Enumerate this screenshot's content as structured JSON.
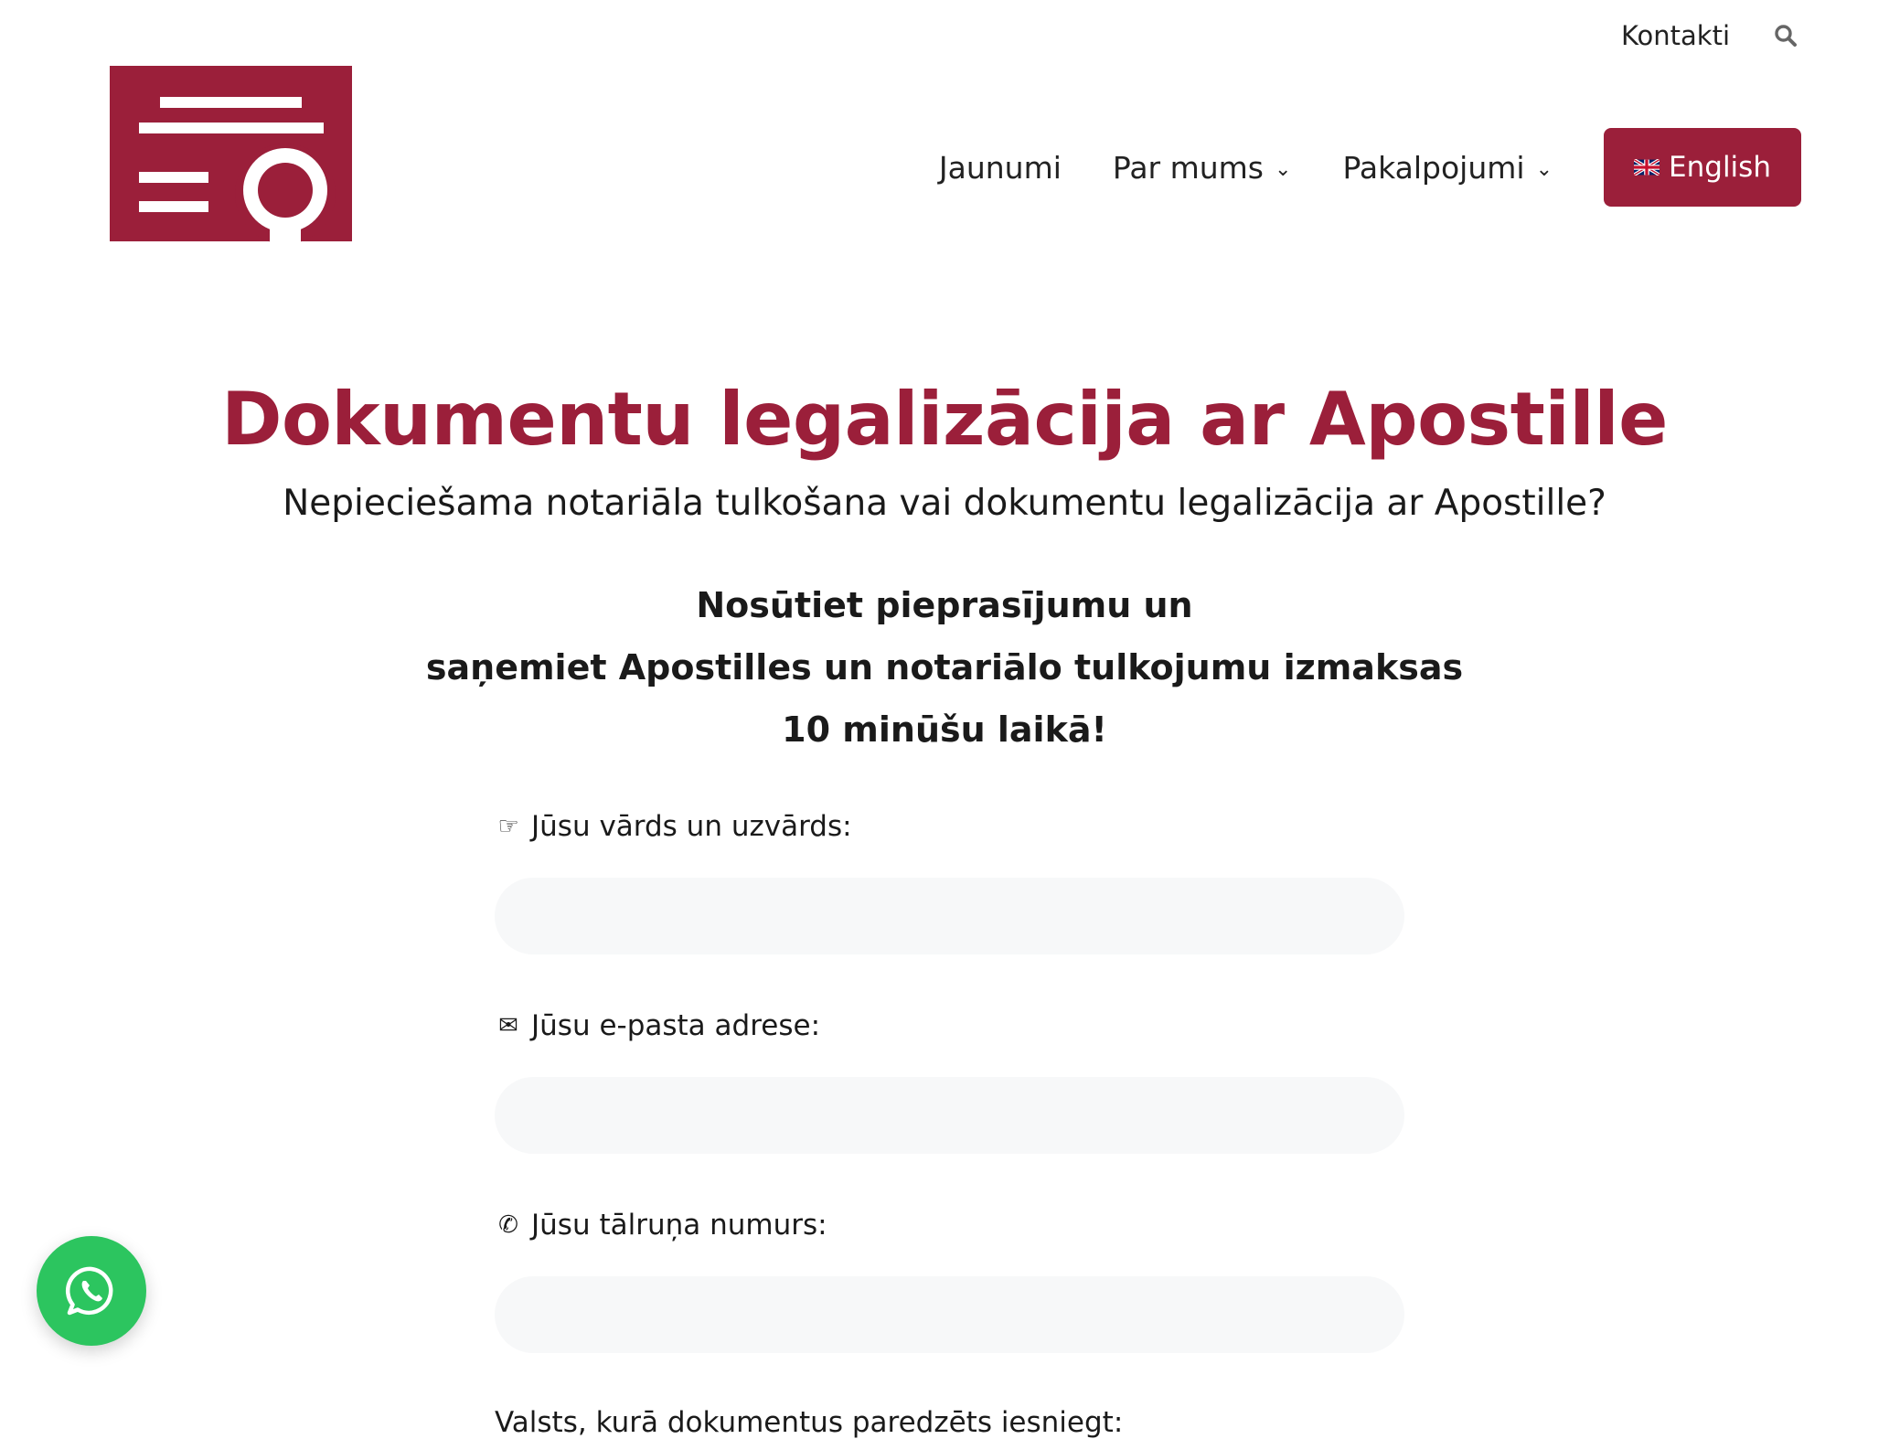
{
  "header": {
    "contacts_link": "Kontakti",
    "search_icon": "search-icon",
    "logo_icon": "certificate-icon",
    "nav": [
      {
        "label": "Jaunumi",
        "has_dropdown": false
      },
      {
        "label": "Par mums",
        "has_dropdown": true
      },
      {
        "label": "Pakalpojumi",
        "has_dropdown": true
      }
    ],
    "language_button": {
      "label": "English",
      "icon": "uk-flag-icon"
    },
    "brand_color": "#9b1f3a"
  },
  "hero": {
    "title": "Dokumentu legalizācija ar Apostille",
    "subtitle": "Nepieciešama notariāla tulkošana vai dokumentu legalizācija ar Apostille?",
    "cta_lines": [
      "Nosūtiet pieprasījumu un",
      "saņemiet Apostilles un notariālo tulkojumu izmaksas",
      "10 minūšu laikā!"
    ]
  },
  "form": {
    "fields": [
      {
        "icon": "pointing-hand-icon",
        "glyph": "☞",
        "label": "Jūsu vārds un uzvārds:",
        "value": "",
        "placeholder": ""
      },
      {
        "icon": "envelope-icon",
        "glyph": "✉",
        "label": "Jūsu e-pasta adrese:",
        "value": "",
        "placeholder": ""
      },
      {
        "icon": "phone-icon",
        "glyph": "✆",
        "label": "Jūsu tālruņa numurs:",
        "value": "",
        "placeholder": ""
      }
    ],
    "country_label": "Valsts, kurā dokumentus paredzēts iesniegt:"
  },
  "floating": {
    "whatsapp_icon": "whatsapp-icon",
    "color": "#2cc55f"
  }
}
